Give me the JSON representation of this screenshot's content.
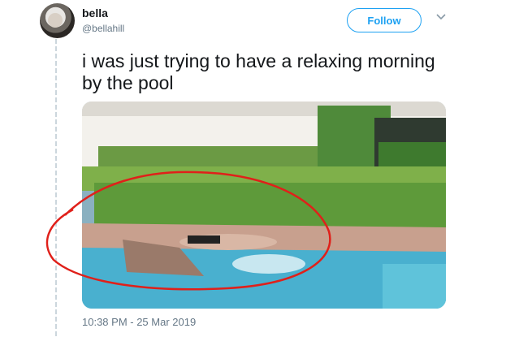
{
  "tweet": {
    "author_name": "bella",
    "author_handle": "@bellahill",
    "follow_label": "Follow",
    "text": "i was just trying to have a relaxing morning by the pool",
    "timestamp": "10:38 PM - 25 Mar 2019"
  },
  "icons": {
    "more": "chevron-down-icon",
    "avatar": "avatar"
  },
  "colors": {
    "accent": "#1da1f2",
    "text": "#14171a",
    "secondary": "#657786",
    "annotation": "#e0201a"
  }
}
